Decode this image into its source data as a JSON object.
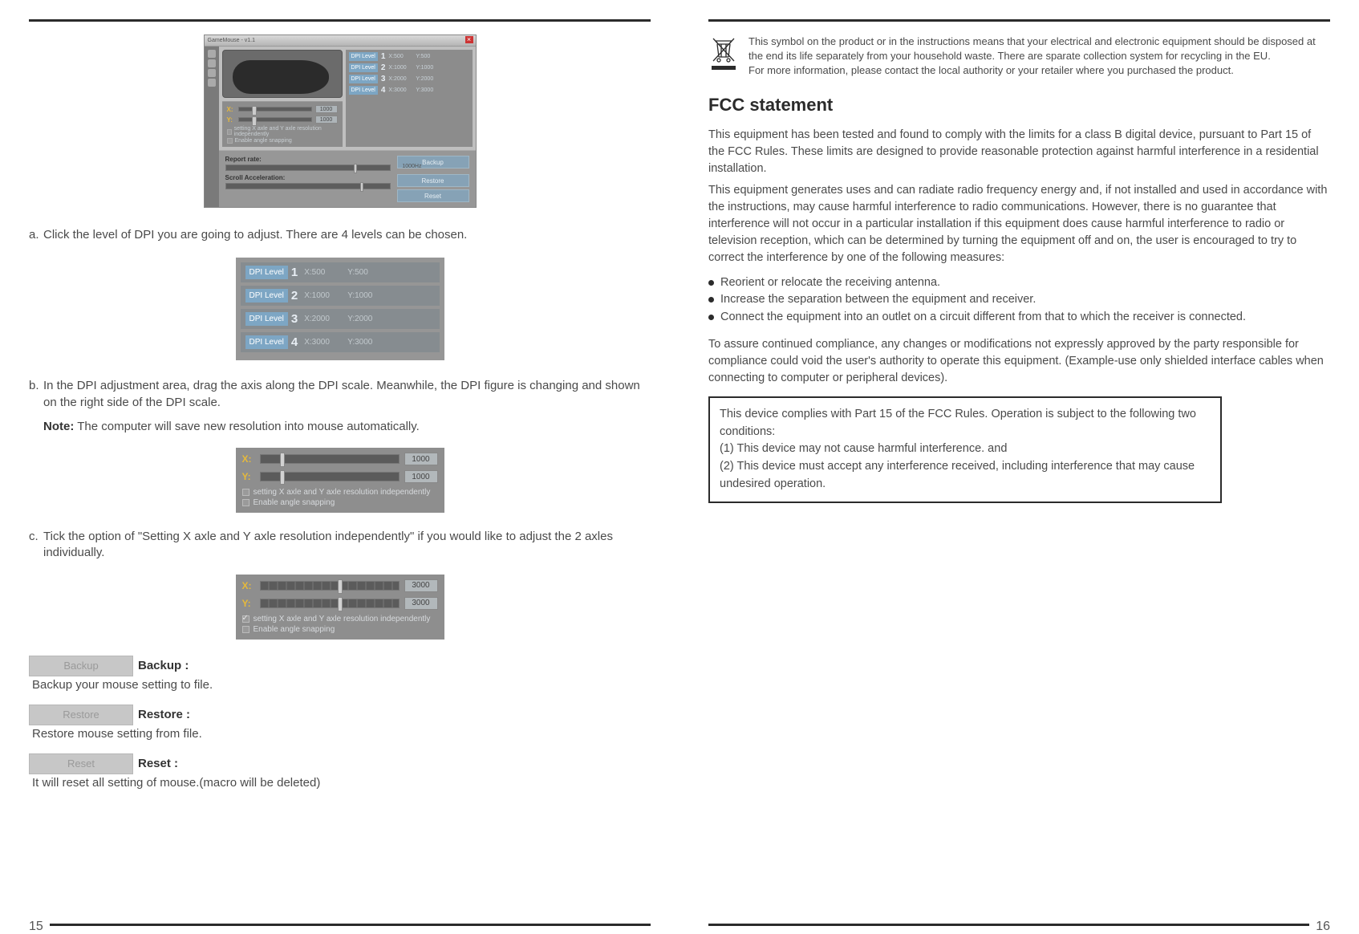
{
  "left": {
    "pageNumber": "15",
    "figMain": {
      "title": "GameMouse - v1.1",
      "dpiLevels": [
        {
          "label": "DPI Level",
          "digit": "1",
          "x": "X:500",
          "y": "Y:500"
        },
        {
          "label": "DPI Level",
          "digit": "2",
          "x": "X:1000",
          "y": "Y:1000"
        },
        {
          "label": "DPI Level",
          "digit": "3",
          "x": "X:2000",
          "y": "Y:2000"
        },
        {
          "label": "DPI Level",
          "digit": "4",
          "x": "X:3000",
          "y": "Y:3000"
        }
      ],
      "sliderX": {
        "axis": "X:",
        "val": "1000"
      },
      "sliderY": {
        "axis": "Y:",
        "val": "1000"
      },
      "chk1": "setting X axle and Y axle resolution independently",
      "chk2": "Enable angle snapping",
      "reportRate": "Report rate:",
      "reportVal": "1000Hz",
      "scrollAcc": "Scroll Acceleration:",
      "btnBackup": "Backup",
      "btnRestore": "Restore",
      "btnReset": "Reset"
    },
    "stepA": "Click the level of DPI you are going to adjust. There are 4 levels can be chosen.",
    "figLevels": [
      {
        "label": "DPI Level",
        "digit": "1",
        "x": "X:500",
        "y": "Y:500"
      },
      {
        "label": "DPI Level",
        "digit": "2",
        "x": "X:1000",
        "y": "Y:1000"
      },
      {
        "label": "DPI Level",
        "digit": "3",
        "x": "X:2000",
        "y": "Y:2000"
      },
      {
        "label": "DPI Level",
        "digit": "4",
        "x": "X:3000",
        "y": "Y:3000"
      }
    ],
    "stepB": "In the DPI adjustment area, drag the axis along the DPI scale.   Meanwhile, the DPI figure is changing and shown on the right side of the DPI scale.",
    "noteLabel": "Note:",
    "noteText": " The computer will save new resolution into mouse automatically.",
    "figXY1": {
      "x": {
        "axis": "X:",
        "val": "1000",
        "knob": "14%"
      },
      "y": {
        "axis": "Y:",
        "val": "1000",
        "knob": "14%"
      },
      "chk1": {
        "text": "setting X axle and Y axle resolution independently",
        "checked": false
      },
      "chk2": {
        "text": "Enable angle snapping",
        "checked": false
      }
    },
    "stepC": "Tick the option of  \"Setting X axle and Y axle resolution independently\" if you would like to adjust the 2 axles individually.",
    "figXY2": {
      "x": {
        "axis": "X:",
        "val": "3000",
        "knob": "56%"
      },
      "y": {
        "axis": "Y:",
        "val": "3000",
        "knob": "56%"
      },
      "chk1": {
        "text": "setting X axle and Y axle resolution independently",
        "checked": true
      },
      "chk2": {
        "text": "Enable angle snapping",
        "checked": false
      }
    },
    "btnBackup": {
      "btn": "Backup",
      "title": "Backup :",
      "desc": "Backup your mouse setting to file."
    },
    "btnRestore": {
      "btn": "Restore",
      "title": "Restore :",
      "desc": "Restore mouse setting from file."
    },
    "btnReset": {
      "btn": "Reset",
      "title": "Reset :",
      "desc": "It will reset all setting of mouse.(macro will be deleted)"
    }
  },
  "right": {
    "pageNumber": "16",
    "weee": {
      "p1": "This symbol on the product or in the instructions means that your electrical and electronic equipment should be disposed at the end its life separately from your household waste. There are sparate collection system for recycling in the EU.",
      "p2": "For more information, please contact the local authority or your retailer where you purchased the product."
    },
    "fccHeading": "FCC statement",
    "fccP1": "This equipment has been tested and found to comply with the limits for a class B digital device, pursuant to Part 15 of the FCC Rules. These limits are designed to provide reasonable protection against harmful interference in a residential installation.",
    "fccP2": "This equipment generates uses and can radiate radio frequency energy and, if not installed and used in accordance with the instructions, may cause harmful interference to radio communications. However, there is no guarantee that interference will not occur in a particular installation if this equipment does cause harmful interference to radio or television reception, which can be determined by turning the equipment off and on, the user is encouraged to try to correct the interference by one of the following measures:",
    "bullets": [
      "Reorient or relocate the receiving antenna.",
      "Increase the separation between the equipment and receiver.",
      "Connect the equipment into an outlet on a circuit different from that to which the receiver is connected."
    ],
    "fccP3": "To assure continued compliance, any changes or modifications not expressly approved by the party responsible for compliance could void the user's authority to operate this equipment. (Example-use only shielded interface cables when connecting to computer or peripheral devices).",
    "box": {
      "l1": "This device complies with Part 15 of the FCC Rules. Operation is subject to the following two conditions:",
      "l2": "(1) This device may not cause harmful interference. and",
      "l3": "(2) This device must accept any interference received, including interference that may cause undesired operation."
    }
  }
}
